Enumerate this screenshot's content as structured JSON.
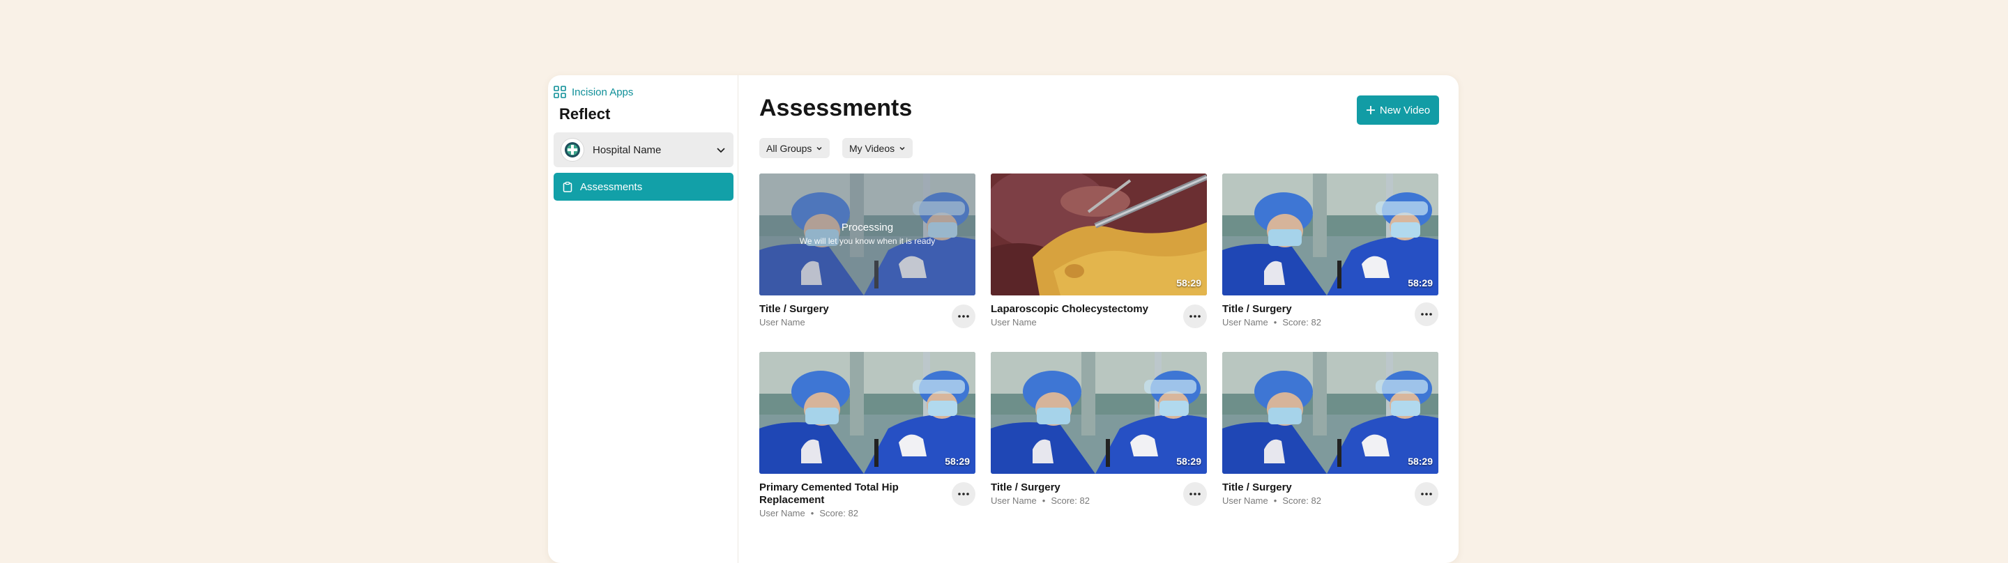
{
  "sidebar": {
    "apps_link": "Incision Apps",
    "product_name": "Reflect",
    "hospital_select": "Hospital Name",
    "nav_items": [
      {
        "label": "Assessments",
        "active": true
      }
    ]
  },
  "main": {
    "title": "Assessments",
    "new_button": "New Video",
    "filters": [
      {
        "label": "All Groups"
      },
      {
        "label": "My Videos"
      }
    ]
  },
  "videos": [
    {
      "title": "Title / Surgery",
      "user": "User Name",
      "score": "",
      "duration": "",
      "thumbnail": "surgeons",
      "processing": true,
      "processing_title": "Processing",
      "processing_sub": "We will let you know when it is ready"
    },
    {
      "title": "Laparoscopic Cholecystectomy",
      "user": "User Name",
      "score": "",
      "duration": "58:29",
      "thumbnail": "laparoscopic",
      "processing": false
    },
    {
      "title": "Title / Surgery",
      "user": "User Name",
      "score": "Score: 82",
      "duration": "58:29",
      "thumbnail": "surgeons",
      "processing": false
    },
    {
      "title": "Primary Cemented Total Hip Replacement",
      "user": "User Name",
      "score": "Score: 82",
      "duration": "58:29",
      "thumbnail": "surgeons",
      "processing": false
    },
    {
      "title": "Title / Surgery",
      "user": "User Name",
      "score": "Score: 82",
      "duration": "58:29",
      "thumbnail": "surgeons",
      "processing": false
    },
    {
      "title": "Title / Surgery",
      "user": "User Name",
      "score": "Score: 82",
      "duration": "58:29",
      "thumbnail": "surgeons",
      "processing": false
    }
  ],
  "colors": {
    "accent": "#129ca5",
    "background": "#f9f1e7",
    "muted_text": "#7a7a7a"
  },
  "icons": [
    "grid-apps-icon",
    "hospital-logo-icon",
    "chevron-down-icon",
    "clipboard-icon",
    "plus-icon",
    "more-icon"
  ]
}
